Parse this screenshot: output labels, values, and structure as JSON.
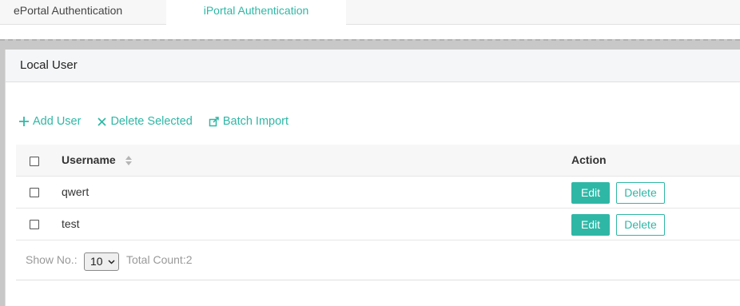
{
  "tabs": [
    {
      "label": "ePortal Authentication",
      "active": false
    },
    {
      "label": "iPortal Authentication",
      "active": true
    }
  ],
  "panel": {
    "title": "Local User"
  },
  "toolbar": {
    "add_label": "Add User",
    "delete_label": "Delete Selected",
    "import_label": "Batch Import"
  },
  "table": {
    "headers": {
      "username": "Username",
      "action": "Action"
    },
    "rows": [
      {
        "username": "qwert",
        "edit": "Edit",
        "delete": "Delete"
      },
      {
        "username": "test",
        "edit": "Edit",
        "delete": "Delete"
      }
    ]
  },
  "footer": {
    "show_no_label": "Show No.:",
    "page_size": "10",
    "total_label": "Total Count:2"
  },
  "colors": {
    "accent": "#2fb7a6"
  },
  "icons": {
    "add": "plus-icon",
    "delete": "close-icon",
    "import": "import-icon",
    "sort": "sort-icon",
    "select": "chevron-down-icon"
  }
}
